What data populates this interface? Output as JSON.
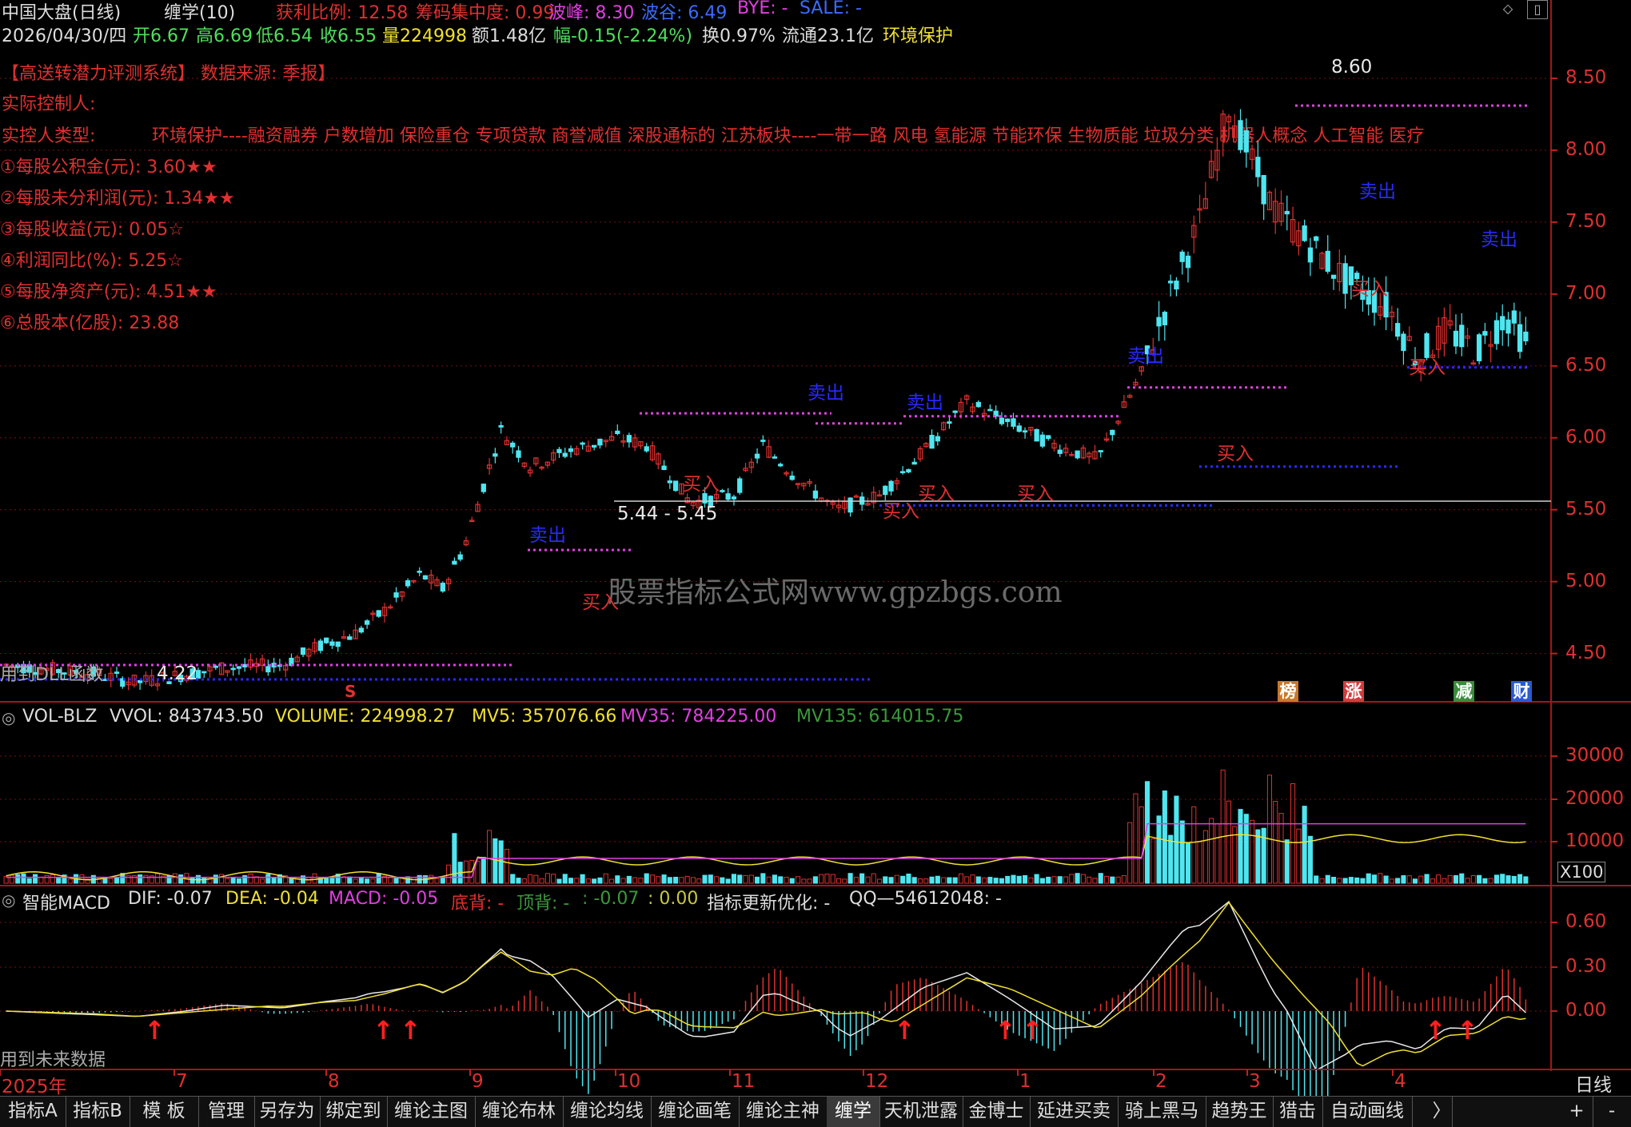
{
  "header": {
    "stock_title": "中国大盘(日线)",
    "indicator_main": "缠学(10)",
    "winners_label": "获利比例: 12.58",
    "concentration_label": "筹码集中度: 0.99",
    "peak_label": "波峰: 8.30",
    "valley_label": "波谷: 6.49",
    "bye_label": "BYE: -",
    "sale_label": "SALE: -"
  },
  "quote": {
    "date": "2026/04/30/四",
    "open": "开6.67",
    "high": "高6.69",
    "low": "低6.54",
    "close": "收6.55",
    "volume": "量224998",
    "amount": "额1.48亿",
    "change": "幅-0.15(-2.24%)",
    "turnover": "换0.97%",
    "float": "流通23.1亿",
    "industry": "环境保护"
  },
  "fundamentals": {
    "system_line": "【高送转潜力评测系统】  数据来源:      季报】",
    "controller": "实际控制人:",
    "controller_type": "实控人类型:",
    "concepts": "环境保护----融资融券 户数增加 保险重仓 专项贷款 商誉减值 深股通标的 江苏板块----一带一路 风电 氢能源 节能环保 生物质能 垃圾分类 机器人概念 人工智能 医疗",
    "items": [
      "①每股公积金(元): 3.60★★",
      "②每股未分利润(元): 1.34★★",
      "③每股收益(元): 0.05☆",
      "④利润同比(%): 5.25☆",
      "⑤每股净资产(元): 4.51★★",
      "⑥总股本(亿股): 23.88"
    ]
  },
  "main_chart": {
    "watermark": "股票指标公式网www.gpzbgs.com",
    "range_label": "5.44 - 5.45",
    "high_marker": "8.60",
    "low_marker": "4.22",
    "dll_note": "用到DLL函数",
    "s_marker": "S",
    "buy_label": "买入",
    "sell_label": "卖出",
    "badges": [
      "榜",
      "涨",
      "减",
      "财"
    ],
    "badge_colors": [
      "#c8782a",
      "#d23c3c",
      "#3c8c3c",
      "#2a5ad2"
    ],
    "y_ticks": [
      "8.50",
      "8.00",
      "7.50",
      "7.00",
      "6.50",
      "6.00",
      "5.50",
      "5.00",
      "4.50"
    ]
  },
  "volume_panel": {
    "name": "VOL-BLZ",
    "vvol": "VVOL: 843743.50",
    "volume": "VOLUME: 224998.27",
    "mv5": "MV5: 357076.66",
    "mv35": "MV35: 784225.00",
    "mv135": "MV135: 614015.75",
    "y_ticks": [
      "30000",
      "20000",
      "10000"
    ],
    "unit": "X100"
  },
  "macd_panel": {
    "name": "智能MACD",
    "dif": "DIF: -0.07",
    "dea": "DEA: -0.04",
    "macd": "MACD: -0.05",
    "bottom": "底背: -",
    "top": "顶背: -",
    "extra": ": -0.07",
    "extra2": ": 0.00",
    "optimize": "指标更新优化: -",
    "qq": "QQ—54612048: -",
    "future_note": "用到未来数据",
    "y_ticks": [
      "0.60",
      "0.30",
      "0.00"
    ]
  },
  "x_axis": {
    "labels": [
      "2025年",
      "7",
      "8",
      "9",
      "10",
      "11",
      "12",
      "1",
      "2",
      "3",
      "4"
    ],
    "period": "日线"
  },
  "tabs": [
    "指标A",
    "指标B",
    "模 板",
    "管理",
    "另存为",
    "绑定到",
    "缠论主图",
    "缠论布林",
    "缠论均线",
    "缠论画笔",
    "缠论主神",
    "缠学",
    "天机泄露",
    "金博士",
    "延进买卖",
    "骑上黑马",
    "趋势王",
    "猎击",
    "自动画线"
  ],
  "tabbar_controls": [
    "+",
    "-"
  ],
  "colors": {
    "up": "#e03030",
    "down": "#4fe6f0",
    "sell_line": "#e040e0",
    "buy_line": "#2a2aff",
    "frame": "#a01818"
  }
}
